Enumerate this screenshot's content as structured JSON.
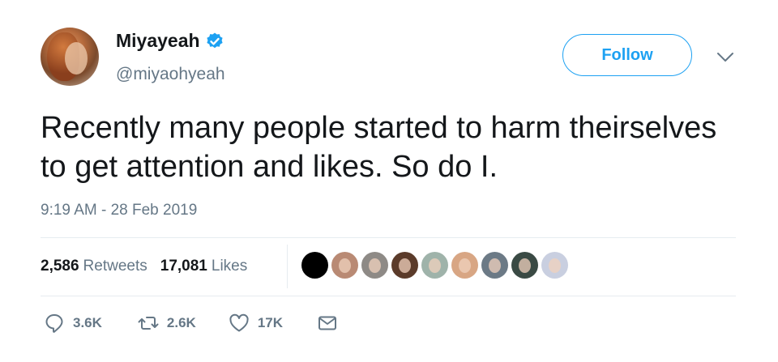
{
  "user": {
    "display_name": "Miyayeah",
    "handle": "@miyaohyeah",
    "verified_icon": "verified-badge-icon",
    "avatar": "profile-avatar"
  },
  "header": {
    "follow_label": "Follow",
    "menu_icon": "chevron-down-icon"
  },
  "tweet": {
    "text": "Recently many people started to harm theirselves to get attention and likes. So do I.",
    "timestamp": "9:19 AM - 28 Feb 2019"
  },
  "stats": {
    "retweets_count": "2,586",
    "retweets_label": "Retweets",
    "likes_count": "17,081",
    "likes_label": "Likes"
  },
  "likers": [
    {
      "name": "liker-avatar-1",
      "color": "#000000"
    },
    {
      "name": "liker-avatar-2",
      "color": "#b98a74"
    },
    {
      "name": "liker-avatar-3",
      "color": "#8e8a86"
    },
    {
      "name": "liker-avatar-4",
      "color": "#5b3b2a"
    },
    {
      "name": "liker-avatar-5",
      "color": "#9fb3aa"
    },
    {
      "name": "liker-avatar-6",
      "color": "#d8a684"
    },
    {
      "name": "liker-avatar-7",
      "color": "#6c7a86"
    },
    {
      "name": "liker-avatar-8",
      "color": "#3a4a44"
    },
    {
      "name": "liker-avatar-9",
      "color": "#c9cfe0"
    }
  ],
  "actions": {
    "reply_count": "3.6K",
    "retweet_count": "2.6K",
    "like_count": "17K"
  },
  "colors": {
    "accent": "#1da1f2",
    "text": "#14171a",
    "muted": "#657786",
    "divider": "#e6ecf0"
  }
}
